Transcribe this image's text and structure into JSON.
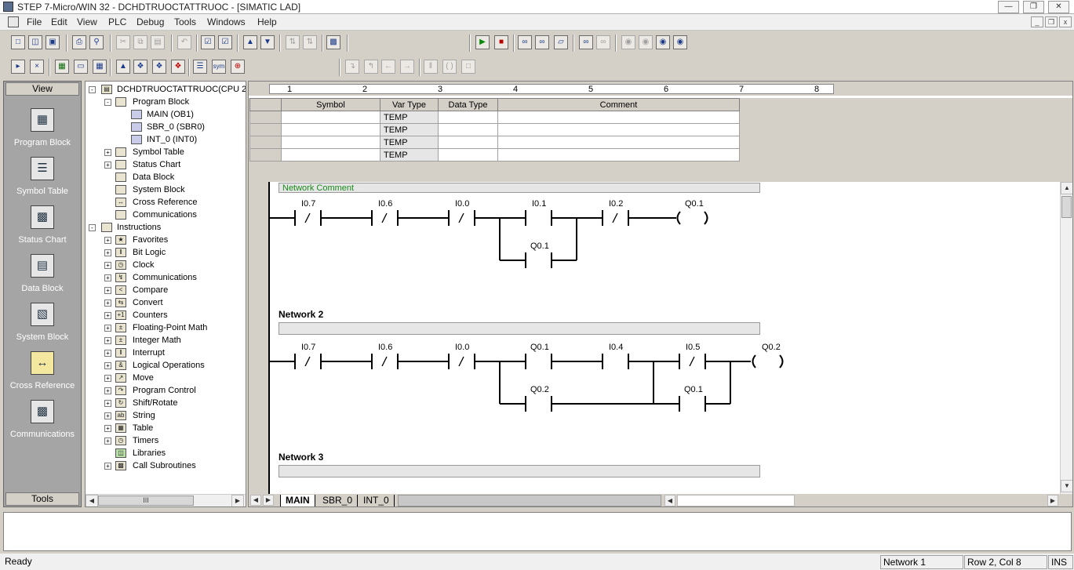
{
  "window": {
    "title": "STEP 7-Micro/WIN 32 - DCHDTRUOCTATTRUOC - [SIMATIC LAD]"
  },
  "menu": [
    "File",
    "Edit",
    "View",
    "PLC",
    "Debug",
    "Tools",
    "Windows",
    "Help"
  ],
  "viewbar": {
    "header": "View",
    "footer": "Tools",
    "items": [
      {
        "label": "Program Block",
        "icon": "program-block-icon"
      },
      {
        "label": "Symbol Table",
        "icon": "symbol-table-icon"
      },
      {
        "label": "Status Chart",
        "icon": "status-chart-icon"
      },
      {
        "label": "Data Block",
        "icon": "data-block-icon"
      },
      {
        "label": "System Block",
        "icon": "system-block-icon"
      },
      {
        "label": "Cross Reference",
        "icon": "cross-reference-icon"
      },
      {
        "label": "Communications",
        "icon": "communications-icon"
      }
    ]
  },
  "tree": {
    "root": "DCHDTRUOCTATTRUOC(CPU 2",
    "program_block": "Program Block",
    "program_children": [
      "MAIN (OB1)",
      "SBR_0 (SBR0)",
      "INT_0 (INT0)"
    ],
    "project_items": [
      "Symbol Table",
      "Status Chart",
      "Data Block",
      "System Block",
      "Cross Reference",
      "Communications"
    ],
    "instructions": "Instructions",
    "instruction_items": [
      "Favorites",
      "Bit Logic",
      "Clock",
      "Communications",
      "Compare",
      "Convert",
      "Counters",
      "Floating-Point Math",
      "Integer Math",
      "Interrupt",
      "Logical Operations",
      "Move",
      "Program Control",
      "Shift/Rotate",
      "String",
      "Table",
      "Timers",
      "Libraries",
      "Call Subroutines"
    ],
    "scroll_grip": "III"
  },
  "ruler": {
    "marks": [
      "1",
      "2",
      "3",
      "4",
      "5",
      "6",
      "7",
      "8"
    ]
  },
  "var_table": {
    "columns": [
      "Symbol",
      "Var Type",
      "Data Type",
      "Comment"
    ],
    "rows": [
      {
        "symbol": "",
        "var_type": "TEMP",
        "data_type": "",
        "comment": ""
      },
      {
        "symbol": "",
        "var_type": "TEMP",
        "data_type": "",
        "comment": ""
      },
      {
        "symbol": "",
        "var_type": "TEMP",
        "data_type": "",
        "comment": ""
      },
      {
        "symbol": "",
        "var_type": "TEMP",
        "data_type": "",
        "comment": ""
      }
    ]
  },
  "ladder": {
    "network_comment": "Network Comment",
    "networks": [
      {
        "title": "",
        "contacts": [
          "I0.7",
          "I0.6",
          "I0.0",
          "I0.1",
          "I0.2"
        ],
        "branch": [
          "Q0.1"
        ],
        "coil": "Q0.1"
      },
      {
        "title": "Network 2",
        "contacts": [
          "I0.7",
          "I0.6",
          "I0.0",
          "Q0.1",
          "I0.4",
          "I0.5"
        ],
        "branch": [
          "Q0.2",
          "Q0.1"
        ],
        "coil": "Q0.2"
      },
      {
        "title": "Network 3"
      }
    ]
  },
  "tabs": [
    "MAIN",
    "SBR_0",
    "INT_0"
  ],
  "status": {
    "ready": "Ready",
    "network": "Network 1",
    "position": "Row 2, Col 8",
    "mode": "INS"
  }
}
